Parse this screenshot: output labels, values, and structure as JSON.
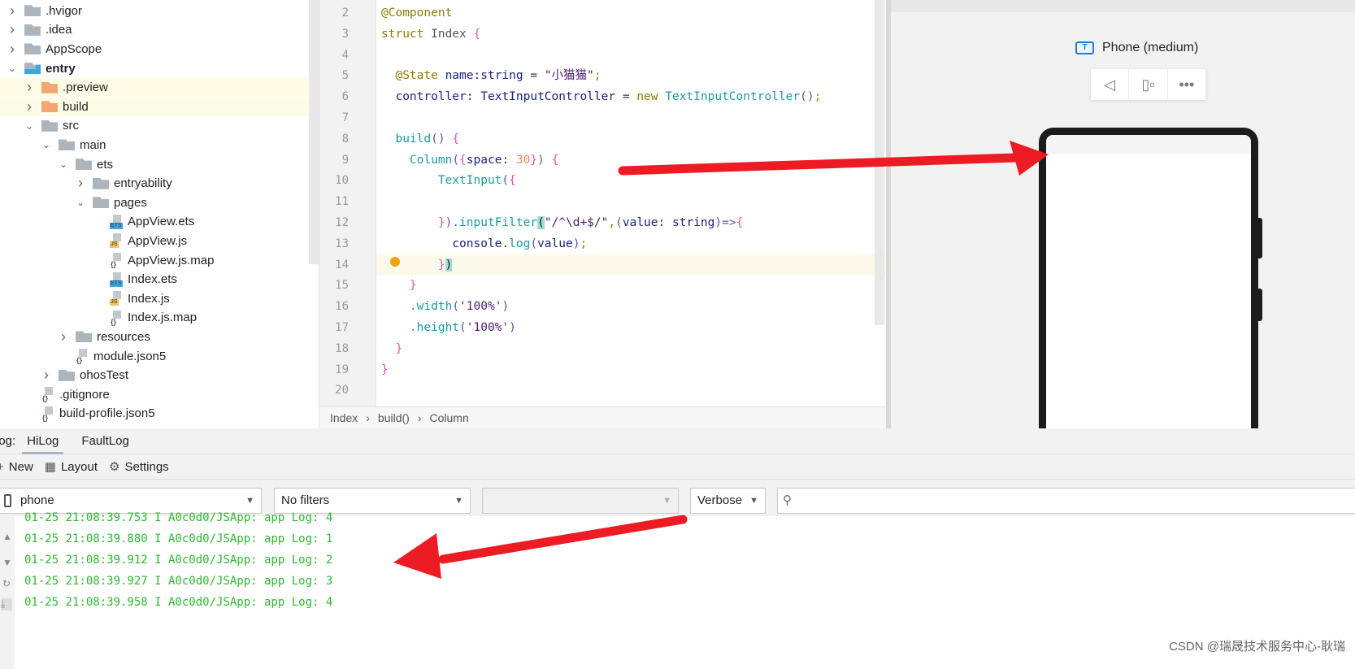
{
  "tree": [
    {
      "label": ".hvigor",
      "depth": 0,
      "kind": "folder",
      "state": "collapsed"
    },
    {
      "label": ".idea",
      "depth": 0,
      "kind": "folder",
      "state": "collapsed"
    },
    {
      "label": "AppScope",
      "depth": 0,
      "kind": "folder",
      "state": "collapsed"
    },
    {
      "label": "entry",
      "depth": 0,
      "kind": "module",
      "state": "expanded",
      "bold": true
    },
    {
      "label": ".preview",
      "depth": 1,
      "kind": "folder-orange",
      "state": "collapsed",
      "highlight": true
    },
    {
      "label": "build",
      "depth": 1,
      "kind": "folder-orange",
      "state": "collapsed",
      "highlight": true
    },
    {
      "label": "src",
      "depth": 1,
      "kind": "folder",
      "state": "expanded"
    },
    {
      "label": "main",
      "depth": 2,
      "kind": "folder",
      "state": "expanded"
    },
    {
      "label": "ets",
      "depth": 3,
      "kind": "folder",
      "state": "expanded"
    },
    {
      "label": "entryability",
      "depth": 4,
      "kind": "folder",
      "state": "collapsed"
    },
    {
      "label": "pages",
      "depth": 4,
      "kind": "folder",
      "state": "expanded"
    },
    {
      "label": "AppView.ets",
      "depth": 5,
      "kind": "ets"
    },
    {
      "label": "AppView.js",
      "depth": 5,
      "kind": "js"
    },
    {
      "label": "AppView.js.map",
      "depth": 5,
      "kind": "map"
    },
    {
      "label": "Index.ets",
      "depth": 5,
      "kind": "ets"
    },
    {
      "label": "Index.js",
      "depth": 5,
      "kind": "js"
    },
    {
      "label": "Index.js.map",
      "depth": 5,
      "kind": "map"
    },
    {
      "label": "resources",
      "depth": 3,
      "kind": "folder",
      "state": "collapsed"
    },
    {
      "label": "module.json5",
      "depth": 3,
      "kind": "map"
    },
    {
      "label": "ohosTest",
      "depth": 2,
      "kind": "folder",
      "state": "collapsed"
    },
    {
      "label": ".gitignore",
      "depth": 1,
      "kind": "map"
    },
    {
      "label": "build-profile.json5",
      "depth": 1,
      "kind": "map"
    }
  ],
  "file_badges": {
    "ets": "ETS",
    "js": "JS",
    "map": "{}"
  },
  "editor": {
    "lines": [
      {
        "n": "2",
        "t": [
          [
            "@Component",
            "kw"
          ]
        ]
      },
      {
        "n": "3",
        "t": [
          [
            "struct ",
            "kw"
          ],
          [
            "Index ",
            "t-ty2"
          ],
          [
            "{",
            "br"
          ]
        ]
      },
      {
        "n": "4",
        "t": []
      },
      {
        "n": "5",
        "t": [
          [
            "  @State ",
            "kw"
          ],
          [
            "name",
            "ty"
          ],
          [
            ":",
            "pl"
          ],
          [
            "string",
            "ty"
          ],
          [
            " = ",
            "pl"
          ],
          [
            "\"小猫猫\"",
            "st"
          ],
          [
            ";",
            "kw"
          ]
        ]
      },
      {
        "n": "6",
        "t": [
          [
            "  controller",
            "ty"
          ],
          [
            ": ",
            "pl"
          ],
          [
            "TextInputController",
            "ty"
          ],
          [
            " = ",
            "pl"
          ],
          [
            "new ",
            "kw"
          ],
          [
            "TextInputController",
            "fn"
          ],
          [
            "()",
            "pu"
          ],
          [
            ";",
            "kw"
          ]
        ]
      },
      {
        "n": "7",
        "t": []
      },
      {
        "n": "8",
        "t": [
          [
            "  build",
            "fn"
          ],
          [
            "() ",
            "pu"
          ],
          [
            "{",
            "br"
          ]
        ]
      },
      {
        "n": "9",
        "t": [
          [
            "    Column",
            "fn"
          ],
          [
            "(",
            "pu"
          ],
          [
            "{",
            "br"
          ],
          [
            "space",
            "ty"
          ],
          [
            ": ",
            "pl"
          ],
          [
            "30",
            "nu"
          ],
          [
            "}",
            "br"
          ],
          [
            ") ",
            "pu"
          ],
          [
            "{",
            "br"
          ]
        ]
      },
      {
        "n": "10",
        "t": [
          [
            "        TextInput",
            "fn"
          ],
          [
            "(",
            "pu"
          ],
          [
            "{",
            "br"
          ]
        ]
      },
      {
        "n": "11",
        "t": []
      },
      {
        "n": "12",
        "t": [
          [
            "        }",
            "br"
          ],
          [
            ").",
            "pu"
          ],
          [
            "inputFilter",
            "fn"
          ],
          [
            "(",
            "mt"
          ],
          [
            "\"/^\\d+$/\"",
            "st"
          ],
          [
            ",",
            "kw"
          ],
          [
            "(",
            "pu"
          ],
          [
            "value",
            "ty"
          ],
          [
            ": ",
            "pl"
          ],
          [
            "string",
            "ty"
          ],
          [
            ")=>",
            "pu"
          ],
          [
            "{",
            "br"
          ]
        ]
      },
      {
        "n": "13",
        "t": [
          [
            "          console",
            "ty"
          ],
          [
            ".",
            "pl"
          ],
          [
            "log",
            "fn"
          ],
          [
            "(",
            "pu"
          ],
          [
            "value",
            "ty"
          ],
          [
            ")",
            "pu"
          ],
          [
            ";",
            "kw"
          ]
        ]
      },
      {
        "n": "14",
        "t": [
          [
            "        }",
            "br"
          ],
          [
            ")",
            "mt"
          ]
        ]
      },
      {
        "n": "15",
        "t": [
          [
            "    }",
            "br"
          ]
        ]
      },
      {
        "n": "16",
        "t": [
          [
            "    .width",
            "fn"
          ],
          [
            "(",
            "pu"
          ],
          [
            "'100%'",
            "st"
          ],
          [
            ")",
            "pu"
          ]
        ]
      },
      {
        "n": "17",
        "t": [
          [
            "    .height",
            "fn"
          ],
          [
            "(",
            "pu"
          ],
          [
            "'100%'",
            "st"
          ],
          [
            ")",
            "pu"
          ]
        ]
      },
      {
        "n": "18",
        "t": [
          [
            "  }",
            "br"
          ]
        ]
      },
      {
        "n": "19",
        "t": [
          [
            "}",
            "br"
          ]
        ]
      },
      {
        "n": "20",
        "t": []
      }
    ],
    "breadcrumb": [
      "Index",
      "build()",
      "Column"
    ]
  },
  "preview": {
    "device": "Phone (medium)",
    "device_icon": "T"
  },
  "log": {
    "label": "Log:",
    "tabs": [
      "HiLog",
      "FaultLog"
    ],
    "active_tab": "HiLog",
    "toolbar": {
      "new": "New",
      "layout": "Layout",
      "settings": "Settings"
    },
    "device": "phone",
    "filter": "No filters",
    "process": "",
    "level": "Verbose",
    "search_placeholder": "",
    "lines": [
      "01-25 21:08:39.753 I A0c0d0/JSApp: app Log: 4",
      "01-25 21:08:39.880 I A0c0d0/JSApp: app Log: 1",
      "01-25 21:08:39.912 I A0c0d0/JSApp: app Log: 2",
      "01-25 21:08:39.927 I A0c0d0/JSApp: app Log: 3",
      "01-25 21:08:39.958 I A0c0d0/JSApp: app Log: 4"
    ]
  },
  "watermark": "CSDN @瑞晟技术服务中心-耿瑞",
  "colors": {
    "annotation_arrow": "#ed1c24",
    "log_text": "#2eb82e",
    "accent": "#1e7be0"
  }
}
